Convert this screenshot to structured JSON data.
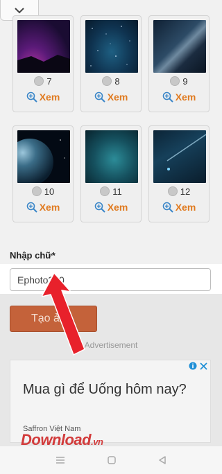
{
  "header": {
    "collapse_icon": "chevron-down-icon"
  },
  "gallery": [
    {
      "number": "7",
      "view_label": "Xem",
      "image": "purple-sky"
    },
    {
      "number": "8",
      "view_label": "Xem",
      "image": "starfield"
    },
    {
      "number": "9",
      "view_label": "Xem",
      "image": "milky-way"
    },
    {
      "number": "10",
      "view_label": "Xem",
      "image": "planet"
    },
    {
      "number": "11",
      "view_label": "Xem",
      "image": "teal-nebula"
    },
    {
      "number": "12",
      "view_label": "Xem",
      "image": "comet"
    }
  ],
  "form": {
    "label": "Nhập chữ*",
    "input_value": "Ephoto360",
    "submit_label": "Tạo ảnh"
  },
  "ad": {
    "label": "Advertisement",
    "headline": "Mua gì để Uống hôm nay?",
    "advertiser": "Saffron Việt Nam"
  },
  "watermark": {
    "main": "Download",
    "suffix": ".vn"
  },
  "colors": {
    "accent": "#e07a1f",
    "button": "#c4623a",
    "arrow": "#e8212b"
  }
}
